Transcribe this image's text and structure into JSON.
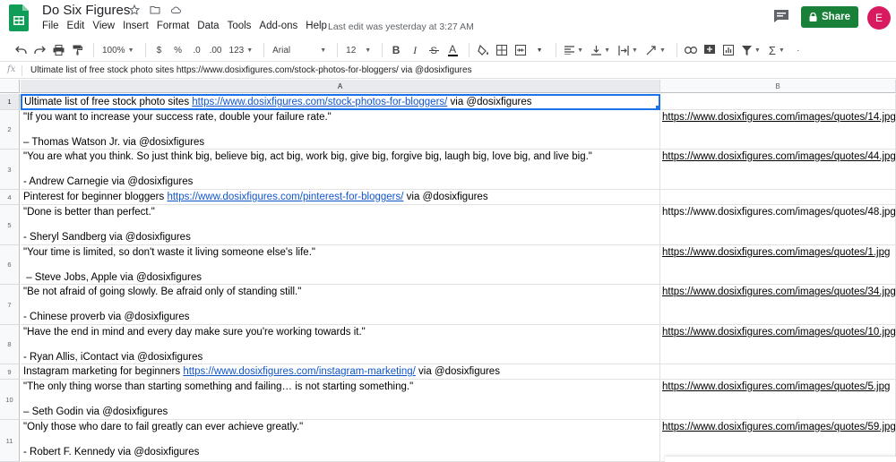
{
  "app": {
    "title": "Do Six Figures",
    "last_edit": "Last edit was yesterday at 3:27 AM",
    "share_label": "Share",
    "avatar_initial": "E",
    "icons": [
      "sheets-logo-icon",
      "star-icon",
      "folder-icon",
      "cloud-icon",
      "comment-icon",
      "lock-icon"
    ],
    "accent_color": "#188038",
    "avatar_color": "#d81b60"
  },
  "menu": [
    "File",
    "Edit",
    "View",
    "Insert",
    "Format",
    "Data",
    "Tools",
    "Add-ons",
    "Help"
  ],
  "toolbar": {
    "zoom": "100%",
    "currency": "$",
    "percent": "%",
    "decrease_decimals": ".0",
    "increase_decimals": ".00",
    "more_formats": "123",
    "font": "Arial",
    "font_size": "12",
    "bold": "B",
    "italic": "I",
    "text_color": "A"
  },
  "formula_bar": {
    "fx": "fx",
    "content": "Ultimate list of free stock photo sites https://www.dosixfigures.com/stock-photos-for-bloggers/ via @dosixfigures"
  },
  "columns": [
    "A",
    "B"
  ],
  "rows": [
    {
      "n": "1",
      "a_pre": "Ultimate list of free stock photo sites ",
      "a_link": "https://www.dosixfigures.com/stock-photos-for-bloggers/",
      "a_post": " via @dosixfigures",
      "b": ""
    },
    {
      "n": "2",
      "a_text": "\"If you want to increase your success rate, double your failure rate.\"\n\n– Thomas Watson Jr. via @dosixfigures",
      "b": "https://www.dosixfigures.com/images/quotes/14.jpg"
    },
    {
      "n": "3",
      "a_text": "\"You are what you think. So just think big, believe big, act big, work big, give big, forgive big, laugh big, love big, and live big.\"\n\n- Andrew Carnegie via @dosixfigures",
      "b": "https://www.dosixfigures.com/images/quotes/44.jpg"
    },
    {
      "n": "4",
      "a_pre": "Pinterest for beginner bloggers ",
      "a_link": "https://www.dosixfigures.com/pinterest-for-bloggers/",
      "a_post": " via @dosixfigures",
      "b": ""
    },
    {
      "n": "5",
      "a_text": "\"Done is better than perfect.\"\n\n- Sheryl Sandberg via @dosixfigures",
      "b": "https://www.dosixfigures.com/images/quotes/48.jpg"
    },
    {
      "n": "6",
      "a_text": "\"Your time is limited, so don't waste it living someone else's life.\"\n\n – Steve Jobs, Apple via @dosixfigures",
      "b": "https://www.dosixfigures.com/images/quotes/1.jpg"
    },
    {
      "n": "7",
      "a_text": "\"Be not afraid of going slowly. Be afraid only of standing still.\"\n\n- Chinese proverb via @dosixfigures",
      "b": "https://www.dosixfigures.com/images/quotes/34.jpg"
    },
    {
      "n": "8",
      "a_text": "\"Have the end in mind and every day make sure you're working towards it.\"\n\n- Ryan Allis, iContact via @dosixfigures",
      "b": "https://www.dosixfigures.com/images/quotes/10.jpg"
    },
    {
      "n": "9",
      "a_pre": "Instagram marketing for beginners ",
      "a_link": "https://www.dosixfigures.com/instagram-marketing/",
      "a_post": " via @dosixfigures",
      "b": ""
    },
    {
      "n": "10",
      "a_text": "\"The only thing worse than starting something and failing… is not starting something.\"\n\n– Seth Godin via @dosixfigures",
      "b": "https://www.dosixfigures.com/images/quotes/5.jpg"
    },
    {
      "n": "11",
      "a_text": "\"Only those who dare to fail greatly can ever achieve greatly.\"\n\n- Robert F. Kennedy via @dosixfigures",
      "b": "https://www.dosixfigures.com/images/quotes/59.jpg"
    }
  ]
}
